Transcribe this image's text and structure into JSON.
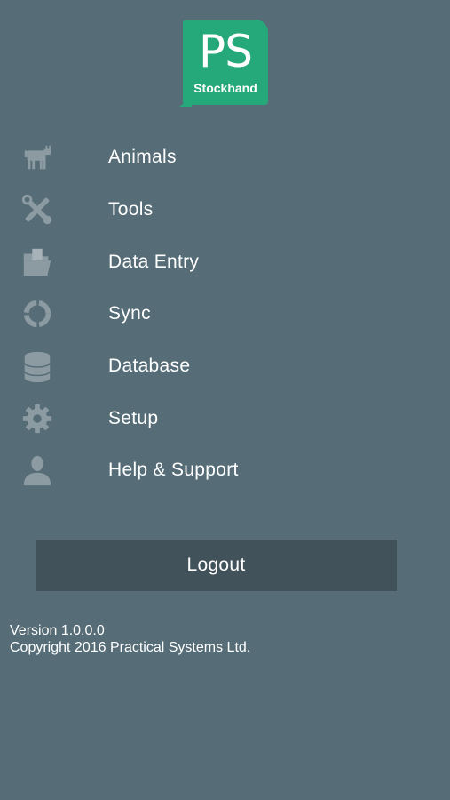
{
  "logo": {
    "initials": "PS",
    "name": "Stockhand"
  },
  "menu": {
    "items": [
      {
        "label": "Animals",
        "icon": "cow-icon"
      },
      {
        "label": "Tools",
        "icon": "tools-icon"
      },
      {
        "label": "Data Entry",
        "icon": "folder-icon"
      },
      {
        "label": "Sync",
        "icon": "sync-icon"
      },
      {
        "label": "Database",
        "icon": "database-icon"
      },
      {
        "label": "Setup",
        "icon": "gear-icon"
      },
      {
        "label": "Help & Support",
        "icon": "person-icon"
      }
    ]
  },
  "logout": {
    "label": "Logout"
  },
  "footer": {
    "version": "Version 1.0.0.0",
    "copyright": "Copyright 2016 Practical Systems Ltd."
  },
  "colors": {
    "background": "#566d77",
    "button": "#42525a",
    "brand": "#25a97a",
    "icon": "#8c9ba2"
  }
}
